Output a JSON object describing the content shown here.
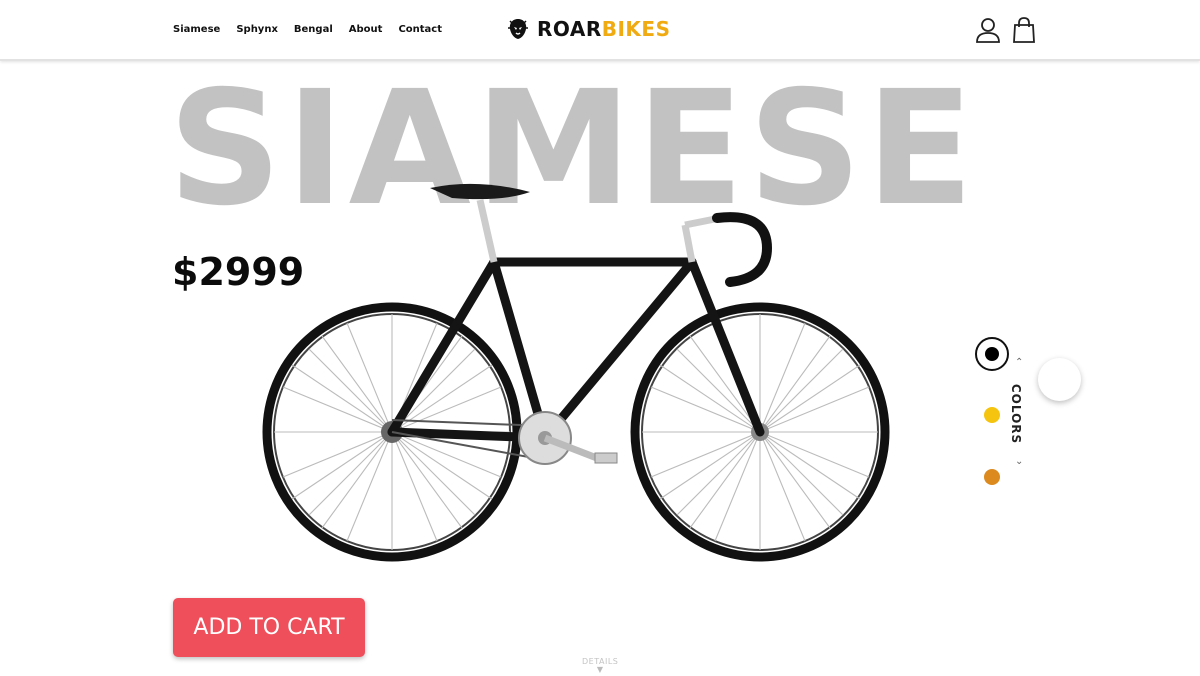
{
  "header": {
    "nav": [
      "Siamese",
      "Sphynx",
      "Bengal",
      "About",
      "Contact"
    ],
    "logo": {
      "part1": "ROAR",
      "part2": "BIKES"
    },
    "icons": [
      "user-icon",
      "shopping-bag-icon"
    ]
  },
  "hero": {
    "title": "SIAMESE",
    "price": "$2999"
  },
  "colors": {
    "label": "COLORS",
    "options": [
      {
        "name": "black",
        "hex": "#000000",
        "selected": true
      },
      {
        "name": "yellow",
        "hex": "#f4c40f"
      },
      {
        "name": "orange",
        "hex": "#dc8a1e"
      }
    ]
  },
  "cta": {
    "add_to_cart": "ADD TO CART",
    "details": "DETAILS"
  },
  "brand_colors": {
    "accent": "#f0ab13",
    "cart": "#ee4f5b"
  }
}
